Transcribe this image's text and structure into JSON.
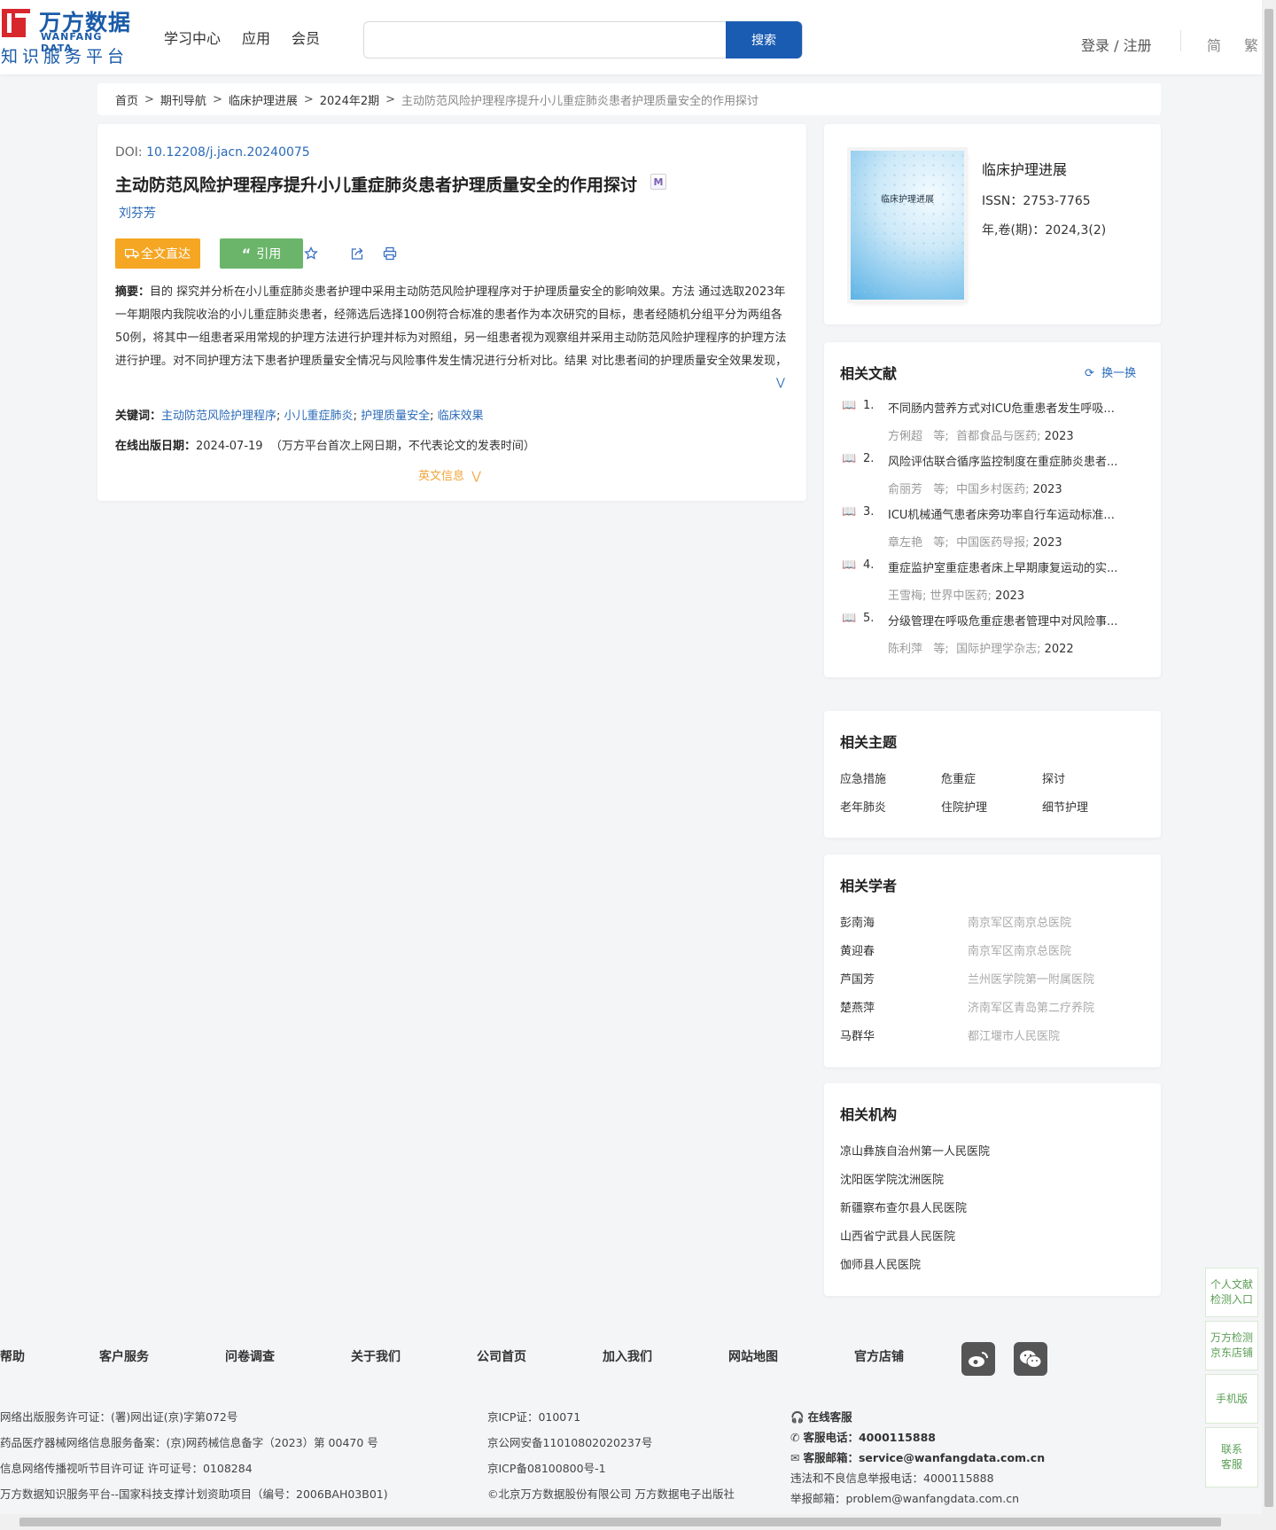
{
  "header": {
    "logo_cn": "万方数据",
    "logo_en": "WANFANG DATA",
    "logo_sub": "知识服务平台",
    "nav": [
      "学习中心",
      "应用",
      "会员"
    ],
    "search_placeholder": "",
    "search_button": "搜索",
    "login": "登录 / 注册",
    "lang_simplified": "简",
    "lang_traditional": "繁"
  },
  "breadcrumb": [
    "首页",
    "期刊导航",
    "临床护理进展",
    "2024年2期",
    "主动防范风险护理程序提升小儿重症肺炎患者护理质量安全的作用探讨"
  ],
  "article": {
    "doi_label": "DOI:",
    "doi": "10.12208/j.jacn.20240075",
    "title": "主动防范风险护理程序提升小儿重症肺炎患者护理质量安全的作用探讨",
    "m_badge": "M",
    "author": "刘芬芳",
    "btn_fulltext": "全文直达",
    "btn_cite": "引用",
    "abstract_label": "摘要：",
    "abstract": "目的 探究并分析在小儿重症肺炎患者护理中采用主动防范风险护理程序对于护理质量安全的影响效果。方法 通过选取2023年一年期限内我院收治的小儿重症肺炎患者，经筛选后选择100例符合标准的患者作为本次研究的目标，患者经随机分组平分为两组各50例，将其中一组患者采用常规的护理方法进行护理并标为对照组，另一组患者视为观察组并采用主动防范风险护理程序的护理方法进行护理。对不同护理方法下患者护理质量安全情况与风险事件发生情况进行分析对比。结果 对比患者间的护理质量安全效果发现，观察组于护理后的各项护理安全评定结果都具有更高的水平（P＜0.05）；观察组…",
    "keywords_label": "关键词：",
    "keywords": [
      "主动防范风险护理程序",
      "小儿重症肺炎",
      "护理质量安全",
      "临床效果"
    ],
    "pubdate_label": "在线出版日期：",
    "pubdate": "2024-07-19",
    "pubdate_note": "（万方平台首次上网日期，不代表论文的发表时间）",
    "en_info": "英文信息"
  },
  "journal": {
    "cover_title": "临床护理进展",
    "name": "临床护理进展",
    "issn": "ISSN：2753-7765",
    "volume": "年,卷(期)：2024,3(2)"
  },
  "related": {
    "title": "相关文献",
    "refresh": "换一换",
    "items": [
      {
        "num": "1.",
        "title": "不同肠内营养方式对ICU危重患者发生呼吸...",
        "authors": "方俐超",
        "et": "等;",
        "source": "首都食品与医药",
        "year": "2023"
      },
      {
        "num": "2.",
        "title": "风险评估联合循序监控制度在重症肺炎患者...",
        "authors": "俞丽芳",
        "et": "等;",
        "source": "中国乡村医药",
        "year": "2023"
      },
      {
        "num": "3.",
        "title": "ICU机械通气患者床旁功率自行车运动标准...",
        "authors": "章左艳",
        "et": "等;",
        "source": "中国医药导报",
        "year": "2023"
      },
      {
        "num": "4.",
        "title": "重症监护室重症患者床上早期康复运动的实...",
        "authors": "王雪梅;",
        "et": "",
        "source": "世界中医药",
        "year": "2023"
      },
      {
        "num": "5.",
        "title": "分级管理在呼吸危重症患者管理中对风险事...",
        "authors": "陈利萍",
        "et": "等;",
        "source": "国际护理学杂志",
        "year": "2022"
      }
    ]
  },
  "topics": {
    "title": "相关主题",
    "items": [
      "应急措施",
      "危重症",
      "探讨",
      "老年肺炎",
      "住院护理",
      "细节护理"
    ]
  },
  "scholars": {
    "title": "相关学者",
    "items": [
      {
        "name": "彭南海",
        "org": "南京军区南京总医院"
      },
      {
        "name": "黄迎春",
        "org": "南京军区南京总医院"
      },
      {
        "name": "芦国芳",
        "org": "兰州医学院第一附属医院"
      },
      {
        "name": "楚燕萍",
        "org": "济南军区青岛第二疗养院"
      },
      {
        "name": "马群华",
        "org": "都江堰市人民医院"
      }
    ]
  },
  "institutions": {
    "title": "相关机构",
    "items": [
      "凉山彝族自治州第一人民医院",
      "沈阳医学院沈洲医院",
      "新疆察布查尔县人民医院",
      "山西省宁武县人民医院",
      "伽师县人民医院"
    ]
  },
  "float_bar": [
    "个人文献检测入口",
    "万方检测京东店铺",
    "手机版",
    "联系客服"
  ],
  "footer": {
    "nav": [
      "帮助",
      "客户服务",
      "问卷调查",
      "关于我们",
      "公司首页",
      "加入我们",
      "网站地图",
      "官方店铺"
    ],
    "col1": [
      "网络出版服务许可证：(署)网出证(京)字第072号",
      "药品医疗器械网络信息服务备案：(京)网药械信息备字（2023）第 00470 号",
      "信息网络传播视听节目许可证 许可证号：0108284",
      "万方数据知识服务平台--国家科技支撑计划资助项目（编号：2006BAH03B01)"
    ],
    "col2": [
      "京ICP证：010071",
      "京公网安备11010802020237号",
      "京ICP备08100800号-1",
      "©北京万方数据股份有限公司 万方数据电子出版社"
    ],
    "online_service": "在线客服",
    "phone_label": "客服电话：",
    "phone": "4000115888",
    "email_label": "客服邮箱：",
    "email": "service@wanfangdata.com.cn",
    "report_phone": "违法和不良信息举报电话：4000115888",
    "report_email": "举报邮箱：problem@wanfangdata.com.cn"
  }
}
